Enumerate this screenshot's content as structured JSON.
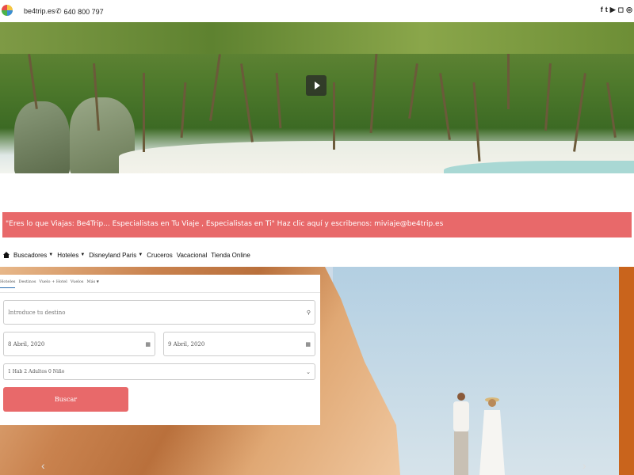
{
  "topbar": {
    "site": "be4trip.es",
    "phone": "640 800 797",
    "social": [
      "f",
      "t",
      "yt",
      "ig",
      "wa"
    ]
  },
  "banner": {
    "text": "\"Eres lo que Viajas: Be4Trip... Especialistas en Tu Viaje , Especialistas en Ti\" Haz clic aquí y escribenos: miviaje@be4trip.es"
  },
  "nav": {
    "items": [
      {
        "label": "Buscadores",
        "dropdown": true
      },
      {
        "label": "Hoteles",
        "dropdown": true
      },
      {
        "label": "Disneyland Paris",
        "dropdown": true
      },
      {
        "label": "Cruceros",
        "dropdown": false
      },
      {
        "label": "Vacacional",
        "dropdown": false
      },
      {
        "label": "Tienda Online",
        "dropdown": false
      }
    ]
  },
  "search": {
    "tabs": [
      "Hoteles",
      "Destinos",
      "Vuelo + Hotel",
      "Vuelos",
      "Más"
    ],
    "destination_placeholder": "Introduce tu destino",
    "checkin": "8 Abril, 2020",
    "checkout": "9 Abril, 2020",
    "rooms": "1 Hab 2 Adultos 0 Niño",
    "submit": "Buscar"
  },
  "colors": {
    "accent": "#e8696a",
    "tab_active": "#2a6db0"
  }
}
